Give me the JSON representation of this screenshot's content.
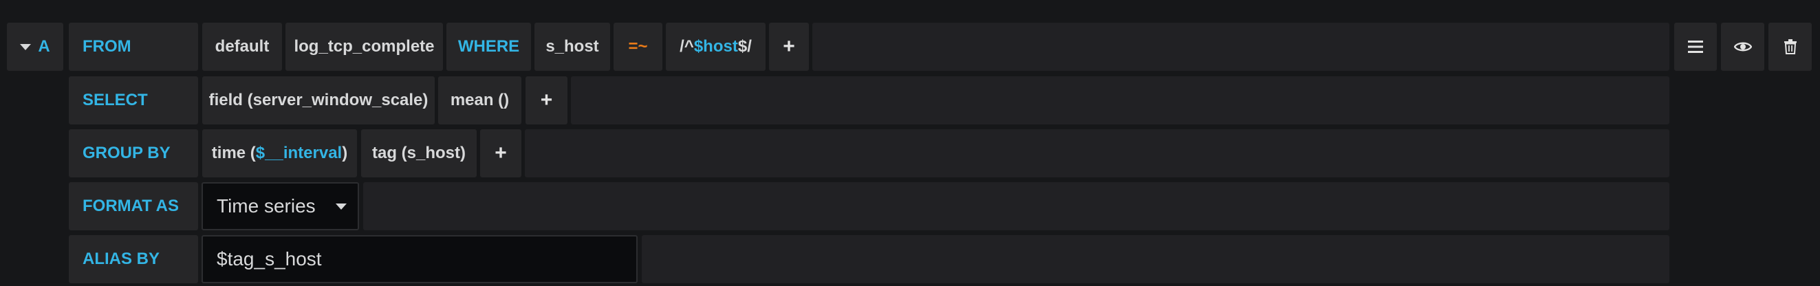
{
  "query": {
    "ref_id": "A",
    "from": {
      "label": "FROM",
      "policy": "default",
      "measurement": "log_tcp_complete",
      "where_label": "WHERE",
      "tag_key": "s_host",
      "operator": "=~",
      "value_prefix": "/^",
      "value_var": "$host",
      "value_suffix": "$/",
      "add_label": "+"
    },
    "select": {
      "label": "SELECT",
      "field": "field (server_window_scale)",
      "aggregation": "mean ()",
      "add_label": "+"
    },
    "group_by": {
      "label": "GROUP BY",
      "time_prefix": "time (",
      "time_var": "$__interval",
      "time_suffix": ")",
      "tag": "tag (s_host)",
      "add_label": "+"
    },
    "format_as": {
      "label": "FORMAT AS",
      "selected": "Time series"
    },
    "alias_by": {
      "label": "ALIAS BY",
      "value": "$tag_s_host"
    }
  },
  "actions": {
    "menu_icon": "hamburger-icon",
    "toggle_icon": "eye-icon",
    "delete_icon": "trash-icon"
  },
  "colors": {
    "background": "#161719",
    "segment": "#262628",
    "keyword": "#33b5e5",
    "operator": "#eb7b18",
    "text": "#d8d9da"
  }
}
